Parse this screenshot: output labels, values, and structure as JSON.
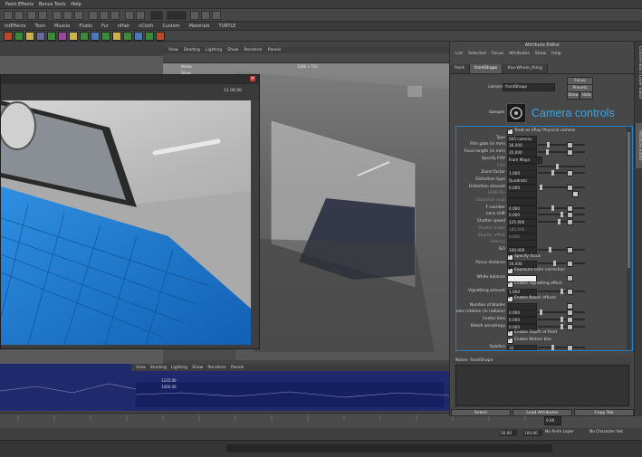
{
  "menubar": {
    "items": [
      "Paint Effects",
      "Bonus Tools",
      "Help"
    ]
  },
  "shelf_tabs": [
    "intEffects",
    "Toon",
    "Muscle",
    "Fluids",
    "Fur",
    "nHair",
    "nCloth",
    "Custom",
    "Materials",
    "TURTLE"
  ],
  "viewport": {
    "menu": [
      "View",
      "Shading",
      "Lighting",
      "Show",
      "Renderer",
      "Panels"
    ],
    "hud_left": "NoHw",
    "hud_resolution": "1280 x 720",
    "hud_left2": "Show"
  },
  "render_window": {
    "title_value": "11 00.00"
  },
  "timeline_menu": [
    "View",
    "Shading",
    "Lighting",
    "Show",
    "Renderer",
    "Panels"
  ],
  "timeline_labels": [
    "1235.00",
    "1000.00"
  ],
  "time_slider": {
    "current": "0.00",
    "range_start": "56.00",
    "range_end": "100.00",
    "anim_layer": "No Anim Layer",
    "char_set": "No Character Set"
  },
  "attribute_editor": {
    "title": "Attribute Editor",
    "menu": [
      "List",
      "Selected",
      "Focus",
      "Attributes",
      "Show",
      "Help"
    ],
    "tabs": [
      "front",
      "frontShape",
      "Xxx-Whole_thing"
    ],
    "camera_label": "camera:",
    "camera_value": "frontShape",
    "focus_button": "Focus",
    "presets_button": "Presets",
    "show_button": "Show",
    "hide_button": "Hide",
    "sample_label": "Sample",
    "big_title": "Camera controls",
    "rows": [
      {
        "type": "check",
        "text": "Treat as VRay Physical camera"
      },
      {
        "type": "value",
        "label": "Type",
        "value": "Still camera"
      },
      {
        "type": "value",
        "label": "Film gate (in mm)",
        "value": "36.000",
        "slider": 0.2,
        "map": true
      },
      {
        "type": "value",
        "label": "Focal length (in mm)",
        "value": "35.000",
        "slider": 0.18,
        "map": true
      },
      {
        "type": "value",
        "label": "Specify FOV",
        "value": "From Maya camera",
        "wide": true
      },
      {
        "type": "value",
        "label": "FOV",
        "value": "",
        "dim": true,
        "slider": 0.4
      },
      {
        "type": "value",
        "label": "Zoom factor",
        "value": "1.000",
        "slider": 0.3,
        "map": true
      },
      {
        "type": "value",
        "label": "Distortion type",
        "value": "Quadratic"
      },
      {
        "type": "value",
        "label": "Distortion amount",
        "value": "0.000",
        "slider": 0.05,
        "map": true
      },
      {
        "type": "value",
        "label": "LENS file",
        "value": "",
        "dim": true,
        "folder": true
      },
      {
        "type": "value",
        "label": "Distortion map",
        "value": "",
        "dim": true
      },
      {
        "type": "value",
        "label": "F-number",
        "value": "4.000",
        "slider": 0.3,
        "map": true
      },
      {
        "type": "value",
        "label": "Lens shift",
        "value": "0.000",
        "slider": 0.5,
        "map": true
      },
      {
        "type": "value",
        "label": "Shutter speed",
        "value": "125.000",
        "slider": 0.45,
        "map": true
      },
      {
        "type": "value",
        "label": "Shutter angle",
        "value": "180.000",
        "dim": true
      },
      {
        "type": "value",
        "label": "Shutter offset",
        "value": "0.000",
        "dim": true
      },
      {
        "type": "value",
        "label": "Latency",
        "value": "",
        "dim": true
      },
      {
        "type": "value",
        "label": "ISO",
        "value": "100.000",
        "slider": 0.25,
        "map": true
      },
      {
        "type": "check",
        "text": "Specify focus"
      },
      {
        "type": "value",
        "label": "Focus distance",
        "value": "50.000",
        "slider": 0.35,
        "map": true
      },
      {
        "type": "check",
        "text": "Exposure color correction"
      },
      {
        "type": "value",
        "label": "White balance",
        "value": "",
        "swatch": true,
        "map": true
      },
      {
        "type": "check",
        "text": "Enable vignetting effect"
      },
      {
        "type": "value",
        "label": "Vignetting amount",
        "value": "1.000",
        "slider": 0.5,
        "map": true
      },
      {
        "type": "check",
        "text": "Enable Bokeh effects"
      },
      {
        "type": "value",
        "label": "Number of blades",
        "value": "",
        "map": true
      },
      {
        "type": "value",
        "label": "Blades rotation (in radians)",
        "value": "0.000",
        "slider": 0.05,
        "map": true
      },
      {
        "type": "value",
        "label": "Center bias",
        "value": "0.000",
        "slider": 0.5,
        "map": true
      },
      {
        "type": "value",
        "label": "Bokeh anisotropy",
        "value": "0.000",
        "slider": 0.5,
        "map": true
      },
      {
        "type": "check",
        "text": "Enable Depth of Field"
      },
      {
        "type": "check",
        "text": "Enable Motion blur"
      },
      {
        "type": "value",
        "label": "Subdivs",
        "value": "32",
        "slider": 0.3,
        "map": true
      }
    ],
    "notes_label": "Notes: frontShape",
    "bottom_buttons": [
      "Select",
      "Load Attributes",
      "Copy Tab"
    ]
  },
  "side_tabs": [
    "Channel Box / Layer Editor",
    "Attribute Editor"
  ],
  "colors": {
    "accent": "#3ba6e6",
    "panel_border": "#1d7fd0",
    "timeline_bg": "#1e2a6b"
  }
}
